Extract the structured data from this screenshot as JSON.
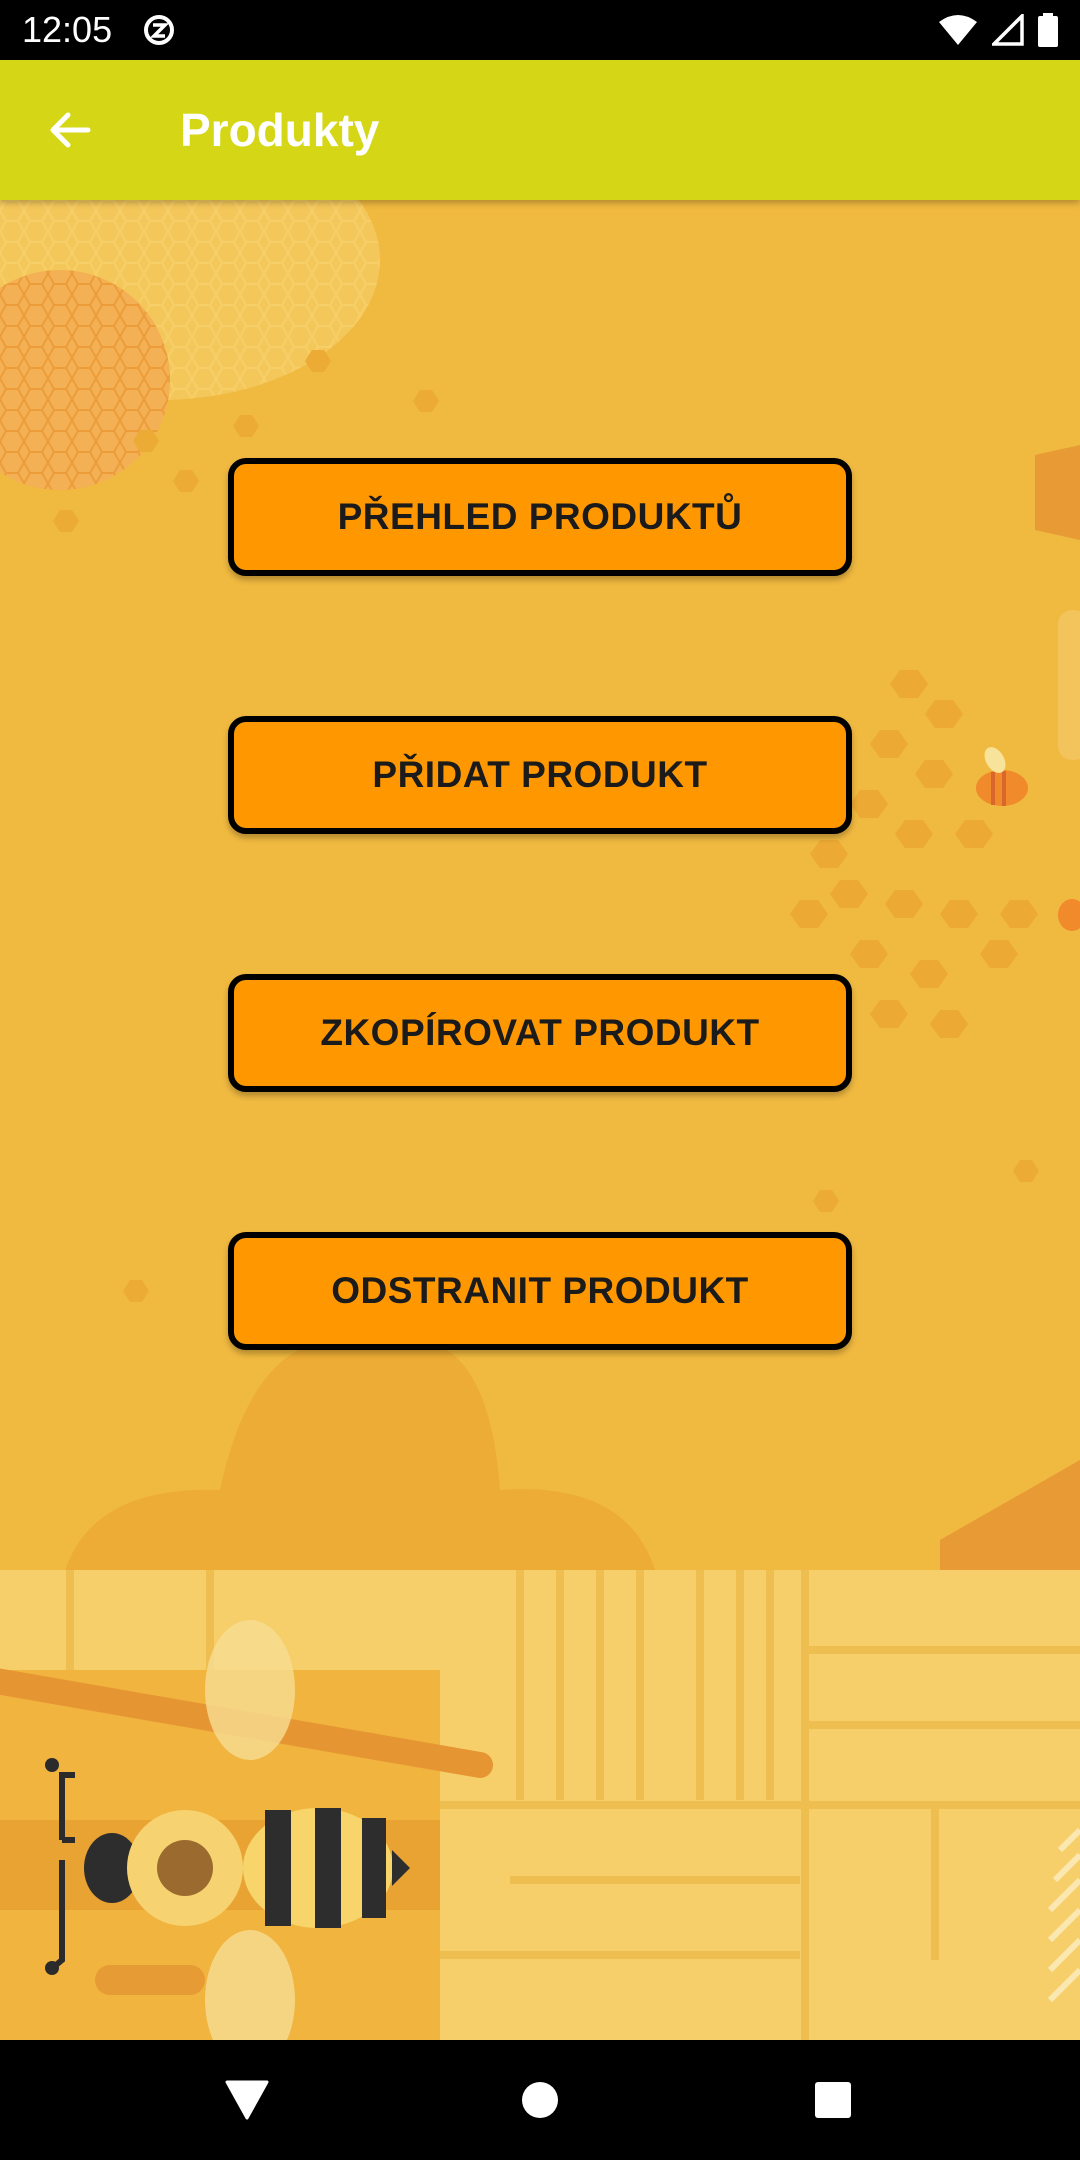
{
  "status_bar": {
    "time": "12:05",
    "icons": [
      "data-saver-icon",
      "wifi-icon",
      "signal-icon",
      "battery-icon"
    ]
  },
  "app_bar": {
    "title": "Produkty",
    "back_icon": "arrow-back-icon",
    "color": "#d5d616"
  },
  "menu": {
    "buttons": [
      {
        "label": "PŘEHLED PRODUKTŮ"
      },
      {
        "label": "PŘIDAT PRODUKT"
      },
      {
        "label": "ZKOPÍROVAT PRODUKT"
      },
      {
        "label": "ODSTRANIT PRODUKT"
      }
    ],
    "button_color": "#ff9800"
  },
  "nav_bar": {
    "icons": [
      "back-triangle-icon",
      "home-circle-icon",
      "recents-square-icon"
    ]
  }
}
